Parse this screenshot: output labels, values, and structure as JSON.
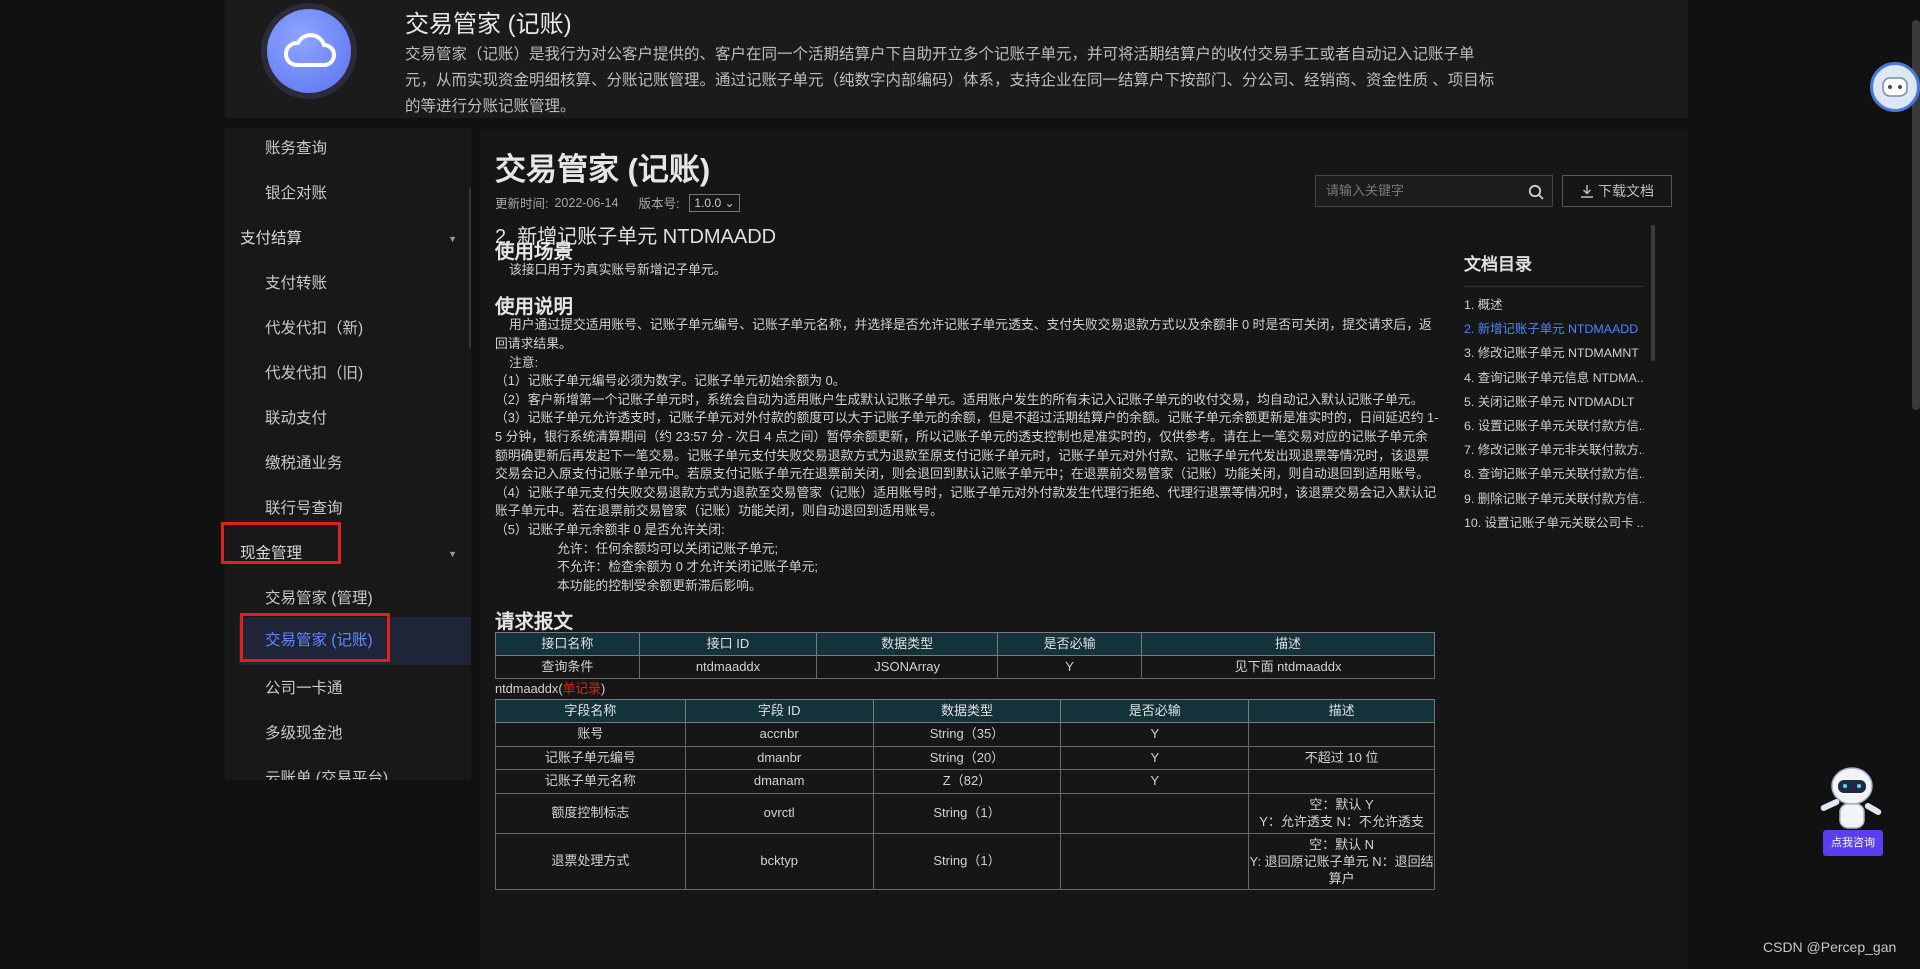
{
  "banner": {
    "title": "交易管家 (记账)",
    "description": "交易管家（记账）是我行为对公客户提供的、客户在同一个活期结算户下自助开立多个记账子单元，并可将活期结算户的收付交易手工或者自动记入记账子单元，从而实现资金明细核算、分账记账管理。通过记账子单元（纯数字内部编码）体系，支持企业在同一结算户下按部门、分公司、经销商、资金性质 、项目标的等进行分账记账管理。"
  },
  "sidebar": {
    "items": [
      {
        "label": "账务查询",
        "kind": "sub"
      },
      {
        "label": "银企对账",
        "kind": "sub"
      },
      {
        "label": "支付结算",
        "kind": "group"
      },
      {
        "label": "支付转账",
        "kind": "sub"
      },
      {
        "label": "代发代扣（新)",
        "kind": "sub"
      },
      {
        "label": "代发代扣（旧)",
        "kind": "sub"
      },
      {
        "label": "联动支付",
        "kind": "sub"
      },
      {
        "label": "缴税通业务",
        "kind": "sub"
      },
      {
        "label": "联行号查询",
        "kind": "sub"
      },
      {
        "label": "现金管理",
        "kind": "group"
      },
      {
        "label": "交易管家 (管理)",
        "kind": "sub"
      },
      {
        "label": "交易管家 (记账)",
        "kind": "active"
      },
      {
        "label": "公司一卡通",
        "kind": "sub"
      },
      {
        "label": "多级现金池",
        "kind": "sub"
      },
      {
        "label": "云账单 (交易平台)",
        "kind": "sub"
      }
    ]
  },
  "doc": {
    "title": "交易管家 (记账)",
    "updated_label": "更新时间:",
    "updated_value": "2022-06-14",
    "version_label": "版本号:",
    "version_value": "1.0.0 ⌄",
    "search_placeholder": "请输入关键字",
    "download_label": "下载文档",
    "section_heading": "2. 新增记账子单元 NTDMAADD",
    "usage_title": "使用场景",
    "usage_text": "该接口用于为真实账号新增记子单元。",
    "desc_title": "使用说明",
    "desc_intro": "用户通过提交适用账号、记账子单元编号、记账子单元名称，并选择是否允许记账子单元透支、支付失败交易退款方式以及余额非 0 时是否可关闭，提交请求后，返回请求结果。",
    "note_label": "注意:",
    "notes": [
      "（1）记账子单元编号必须为数字。记账子单元初始余额为 0。",
      "（2）客户新增第一个记账子单元时，系统会自动为适用账户生成默认记账子单元。适用账户发生的所有未记入记账子单元的收付交易，均自动记入默认记账子单元。",
      "（3）记账子单元允许透支时，记账子单元对外付款的额度可以大于记账子单元的余额，但是不超过活期结算户的余额。记账子单元余额更新是准实时的，日间延迟约 1-5 分钟，银行系统清算期间（约 23:57 分 - 次日 4 点之间）暂停余额更新，所以记账子单元的透支控制也是准实时的，仅供参考。请在上一笔交易对应的记账子单元余额明确更新后再发起下一笔交易。记账子单元支付失败交易退款方式为退款至原支付记账子单元时，记账子单元对外付款、记账子单元代发出现退票等情况时，该退票交易会记入原支付记账子单元中。若原支付记账子单元在退票前关闭，则会退回到默认记账子单元中；在退票前交易管家（记账）功能关闭，则自动退回到适用账号。",
      "（4）记账子单元支付失败交易退款方式为退款至交易管家（记账）适用账号时，记账子单元对外付款发生代理行拒绝、代理行退票等情况时，该退票交易会记入默认记账子单元中。若在退票前交易管家（记账）功能关闭，则自动退回到适用账号。",
      "（5）记账子单元余额非 0 是否允许关闭:"
    ],
    "sub_notes": [
      "允许：任何余额均可以关闭记账子单元;",
      "不允许：检查余额为 0 才允许关闭记账子单元;",
      "本功能的控制受余额更新滞后影响。"
    ],
    "request_title": "请求报文",
    "table1": {
      "headers": [
        "接口名称",
        "接口 ID",
        "数据类型",
        "是否必输",
        "描述"
      ],
      "rows": [
        [
          "查询条件",
          "ntdmaaddx",
          "JSONArray",
          "Y",
          "见下面 ntdmaaddx"
        ]
      ]
    },
    "ntdmaaddx_label": "ntdmaaddx(",
    "ntdmaaddx_red": "单记录",
    "ntdmaaddx_close": ")",
    "table2": {
      "headers": [
        "字段名称",
        "字段 ID",
        "数据类型",
        "是否必输",
        "描述"
      ],
      "rows": [
        [
          "账号",
          "accnbr",
          "String（35）",
          "Y",
          ""
        ],
        [
          "记账子单元编号",
          "dmanbr",
          "String（20）",
          "Y",
          "不超过 10 位"
        ],
        [
          "记账子单元名称",
          "dmanam",
          "Z（82）",
          "Y",
          ""
        ],
        [
          "额度控制标志",
          "ovrctl",
          "String（1）",
          "",
          "空：默认 Y\nY：允许透支 N：不允许透支"
        ],
        [
          "退票处理方式",
          "bcktyp",
          "String（1）",
          "",
          "空：默认 N\nY: 退回原记账子单元 N：退回结算户"
        ]
      ]
    }
  },
  "toc": {
    "title": "文档目录",
    "items": [
      "1. 概述",
      "2. 新增记账子单元 NTDMAADD",
      "3. 修改记账子单元 NTDMAMNT",
      "4. 查询记账子单元信息 NTDMA...",
      "5. 关闭记账子单元 NTDMADLT",
      "6. 设置记账子单元关联付款方信...",
      "7. 修改记账子单元非关联付款方...",
      "8. 查询记账子单元关联付款方信...",
      "9. 删除记账子单元关联付款方信...",
      "10. 设置记账子单元关联公司卡 ..."
    ],
    "active_index": 1
  },
  "widgets": {
    "consult_label": "点我咨询",
    "watermark": "CSDN @Percep_gan"
  },
  "colors": {
    "accent": "#4a86ff",
    "highlight_box": "#e0201c",
    "table_header": "#14323a"
  }
}
